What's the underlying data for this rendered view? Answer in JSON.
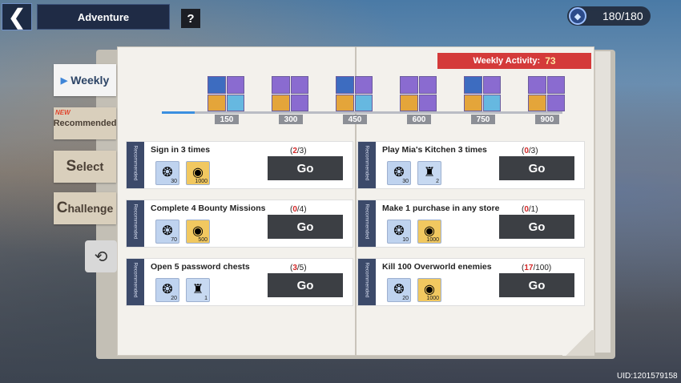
{
  "header": {
    "back_icon": "chevron-left-icon",
    "title": "Adventure",
    "help_label": "?",
    "stamina": "180/180"
  },
  "tabs": [
    {
      "label": "Weekly",
      "active": true
    },
    {
      "label": "Recommended",
      "badge": "NEW"
    },
    {
      "label_first": "S",
      "label_rest": "elect"
    },
    {
      "label_first": "C",
      "label_rest": "hallenge"
    }
  ],
  "activity": {
    "label": "Weekly Activity:",
    "value": "73",
    "progress": 0.081,
    "milestones": [
      "150",
      "300",
      "450",
      "600",
      "750",
      "900"
    ]
  },
  "missions": [
    {
      "tag": "Recommended",
      "title": "Sign in 3 times",
      "progress_current": "2",
      "progress_total": "/3)",
      "rewards": [
        {
          "type": "gem",
          "amount": "30"
        },
        {
          "type": "coin",
          "amount": "1000"
        }
      ],
      "button": "Go"
    },
    {
      "tag": "Recommended",
      "title": "Play Mia's Kitchen 3 times",
      "progress_current": "0",
      "progress_total": "/3)",
      "rewards": [
        {
          "type": "gem",
          "amount": "30"
        },
        {
          "type": "bottle",
          "amount": "2"
        }
      ],
      "button": "Go"
    },
    {
      "tag": "Recommended",
      "title": "Complete 4 Bounty Missions",
      "progress_current": "0",
      "progress_total": "/4)",
      "rewards": [
        {
          "type": "gem",
          "amount": "70"
        },
        {
          "type": "coin",
          "amount": "500"
        }
      ],
      "button": "Go"
    },
    {
      "tag": "Recommended",
      "title": "Make 1 purchase in any store",
      "progress_current": "0",
      "progress_total": "/1)",
      "rewards": [
        {
          "type": "gem",
          "amount": "10"
        },
        {
          "type": "coin",
          "amount": "1000"
        }
      ],
      "button": "Go"
    },
    {
      "tag": "Recommended",
      "title": "Open 5 password chests",
      "progress_current": "3",
      "progress_total": "/5)",
      "rewards": [
        {
          "type": "gem",
          "amount": "20"
        },
        {
          "type": "bottle",
          "amount": "1"
        }
      ],
      "button": "Go"
    },
    {
      "tag": "Recommended",
      "title": "Kill 100 Overworld enemies",
      "progress_current": "17",
      "progress_total": "/100)",
      "rewards": [
        {
          "type": "gem",
          "amount": "20"
        },
        {
          "type": "coin",
          "amount": "1000"
        }
      ],
      "button": "Go"
    }
  ],
  "uid": "UID:1201579158"
}
